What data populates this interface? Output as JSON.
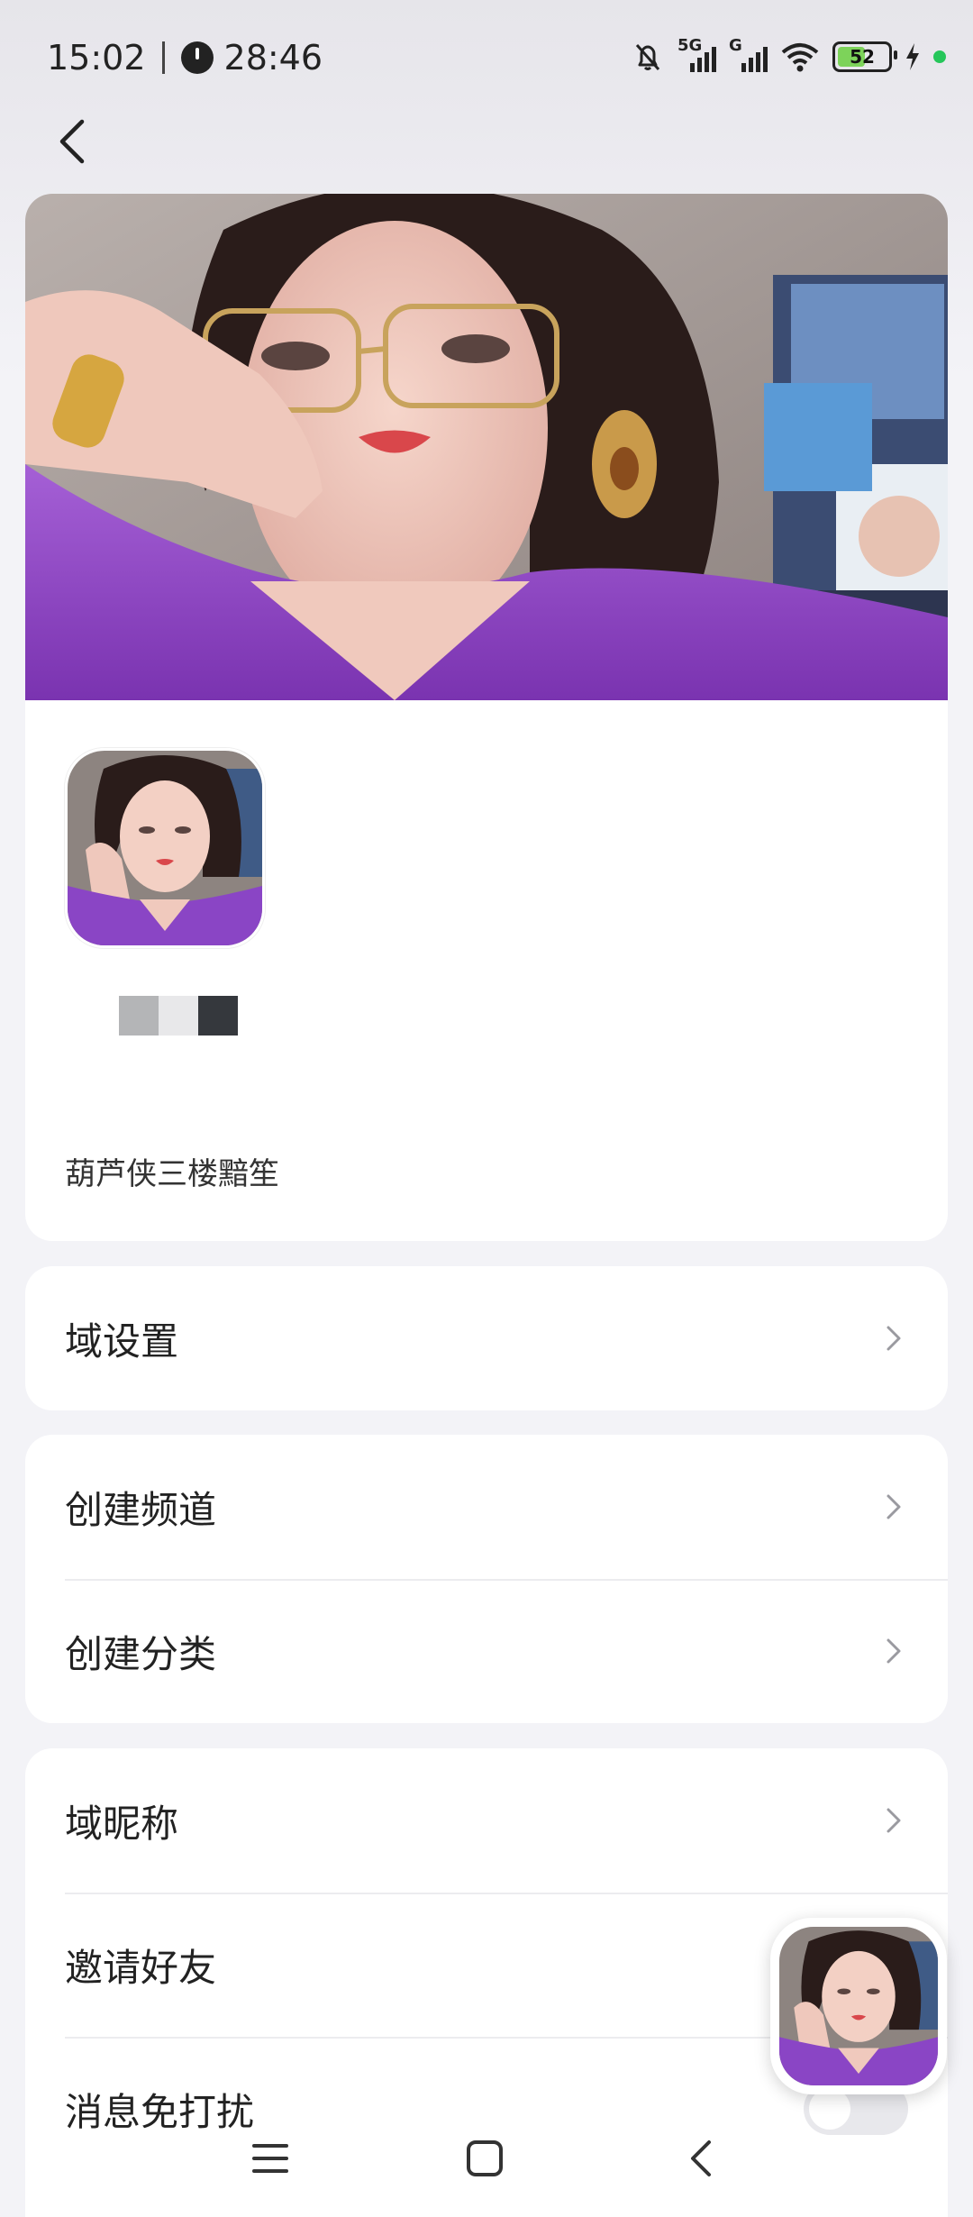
{
  "status_bar": {
    "time": "15:02",
    "timer": "28:46",
    "network_1": "5G",
    "network_2": "G",
    "battery_level": "52",
    "accent_battery": "#7dd35a",
    "dot_color": "#26c65a"
  },
  "nav": {
    "back_icon": "chevron-left-icon"
  },
  "profile": {
    "server_name": "葫芦侠三楼黯笙",
    "swatch_colors": [
      "#b4b5b7",
      "#e8e8ea",
      "#35383d"
    ]
  },
  "groups": [
    {
      "rows": [
        {
          "label": "域设置",
          "accessory": "chevron"
        }
      ]
    },
    {
      "rows": [
        {
          "label": "创建频道",
          "accessory": "chevron"
        },
        {
          "label": "创建分类",
          "accessory": "chevron"
        }
      ]
    },
    {
      "rows": [
        {
          "label": "域昵称",
          "accessory": "chevron"
        },
        {
          "label": "邀请好友",
          "accessory": "chevron"
        },
        {
          "label": "消息免打扰",
          "accessory": "toggle",
          "toggle_on": false
        }
      ]
    }
  ],
  "bottom_nav": {
    "menu_icon": "menu-icon",
    "home_icon": "home-square-icon",
    "back_icon": "back-triangle-icon"
  }
}
